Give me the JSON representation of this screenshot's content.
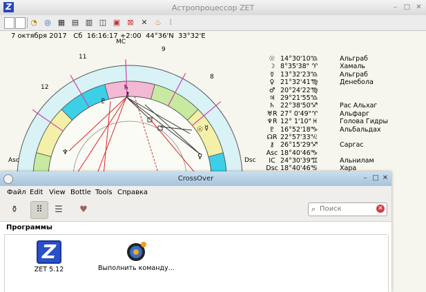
{
  "zet": {
    "title": "Астропроцессор ZET",
    "logo_letter": "Z",
    "window_buttons": {
      "minimize": "–",
      "maximize": "□",
      "close": "✕"
    },
    "info_line": "7 октября 2017   Сб  16:16:17 +2:00  44°36'N  33°32'E",
    "toolbar_icons": [
      "chart-wheel-icon",
      "globe-icon",
      "grid-icon",
      "document-icon",
      "notes-icon",
      "book-icon",
      "table-icon",
      "settings-cross-icon",
      "bell-icon",
      "transit-icon"
    ],
    "chart_labels": {
      "mc": "MC",
      "asc": "Asc",
      "dsc": "Dsc",
      "house_9": "9",
      "house_8": "8",
      "house_11": "11",
      "house_12": "12"
    },
    "planets": [
      {
        "glyph": "☉",
        "pos": "14°30'10\"",
        "sign": "♎",
        "star": "Альграб"
      },
      {
        "glyph": "☽",
        "pos": "8°35'38\"",
        "sign": "♈",
        "star": "Хамаль"
      },
      {
        "glyph": "☿",
        "pos": "13°32'23\"",
        "sign": "♎",
        "star": "Альграб"
      },
      {
        "glyph": "♀",
        "pos": "21°32'41\"",
        "sign": "♍",
        "star": "Денебола"
      },
      {
        "glyph": "♂",
        "pos": "20°24'22\"",
        "sign": "♍",
        "star": ""
      },
      {
        "glyph": "♃",
        "pos": "29°21'55\"",
        "sign": "♎",
        "star": ""
      },
      {
        "glyph": "♄",
        "pos": "22°38'50\"",
        "sign": "♐",
        "star": "Рас Альхаг"
      },
      {
        "glyph": "♅R",
        "pos": "27° 0'49\"",
        "sign": "♈",
        "star": "Альфарг"
      },
      {
        "glyph": "♆R",
        "pos": "12° 1'10\"",
        "sign": "♓",
        "star": "Голова Гидры"
      },
      {
        "glyph": "♇",
        "pos": "16°52'18\"",
        "sign": "♑",
        "star": "Альбальдах"
      },
      {
        "glyph": "☊R",
        "pos": "22°57'33\"",
        "sign": "♌",
        "star": ""
      },
      {
        "glyph": "⚷",
        "pos": "26°15'29\"",
        "sign": "♐",
        "star": "Саргас"
      },
      {
        "glyph": "Asc",
        "pos": "18°40'46\"",
        "sign": "♑",
        "star": ""
      },
      {
        "glyph": "IC",
        "pos": "24°30'39\"",
        "sign": "♊",
        "star": "Альнилам"
      },
      {
        "glyph": "Dsc",
        "pos": "18°40'46\"",
        "sign": "♋",
        "star": "Хара"
      }
    ]
  },
  "crossover": {
    "title": "CrossOver",
    "window_buttons": {
      "minimize": "–",
      "maximize": "□",
      "close": "✕"
    },
    "menu": [
      "Файл",
      "Edit",
      "View",
      "Bottle",
      "Tools",
      "Справка"
    ],
    "toolbar_icons": [
      "bottles-icon",
      "grid-view-icon",
      "list-view-icon",
      "heart-icon"
    ],
    "search_placeholder": "Поиск",
    "section_title": "Программы",
    "programs": [
      {
        "label": "ZET 5.12",
        "icon": "zet-app-icon",
        "letter": "Z"
      },
      {
        "label": "Выполнить команду...",
        "icon": "run-command-icon"
      }
    ]
  },
  "colors": {
    "zodiac_pink": "#f2b8d4",
    "zodiac_cyan": "#3cd0e8",
    "zodiac_green": "#c8eaa0",
    "zodiac_yellow": "#f4f0a8",
    "ring_light": "#d8f2f6",
    "crossover_title": "#b9d4e9"
  }
}
